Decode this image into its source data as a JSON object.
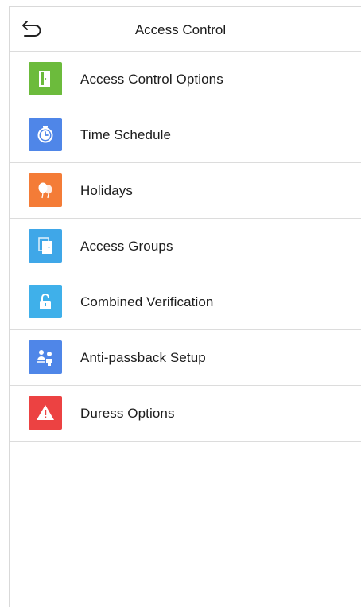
{
  "header": {
    "title": "Access Control",
    "back_icon": "back-arrow-icon"
  },
  "menu": {
    "items": [
      {
        "label": "Access Control Options",
        "icon": "door-icon",
        "color": "#6cbb3c"
      },
      {
        "label": "Time Schedule",
        "icon": "clock-icon",
        "color": "#4f86e8"
      },
      {
        "label": "Holidays",
        "icon": "balloons-icon",
        "color": "#f47c37"
      },
      {
        "label": "Access Groups",
        "icon": "group-doors-icon",
        "color": "#3fa7e8"
      },
      {
        "label": "Combined Verification",
        "icon": "unlock-icon",
        "color": "#3fb0ea"
      },
      {
        "label": "Anti-passback Setup",
        "icon": "people-icon",
        "color": "#4f86e8"
      },
      {
        "label": "Duress Options",
        "icon": "warning-icon",
        "color": "#ec4242"
      }
    ]
  }
}
